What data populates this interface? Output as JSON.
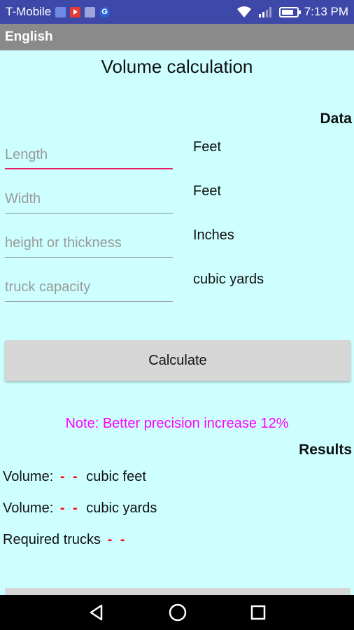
{
  "status_bar": {
    "carrier": "T-Mobile",
    "time": "7:13 PM",
    "icons": [
      "notification-icon",
      "youtube-icon",
      "gallery-icon",
      "google-icon",
      "wifi-icon",
      "signal-icon",
      "battery-icon"
    ]
  },
  "app_bar": {
    "title": "English"
  },
  "page": {
    "title": "Volume calculation",
    "data_label": "Data",
    "results_label": "Results"
  },
  "inputs": {
    "length": {
      "placeholder": "Length",
      "value": "",
      "unit": "Feet"
    },
    "width": {
      "placeholder": "Width",
      "value": "",
      "unit": "Feet"
    },
    "height": {
      "placeholder": "height or thickness",
      "value": "",
      "unit": "Inches"
    },
    "truck": {
      "placeholder": "truck capacity",
      "value": "",
      "unit": "cubic yards"
    }
  },
  "calculate_label": "Calculate",
  "note": "Note: Better precision increase 12%",
  "results": {
    "volume_feet": {
      "label": "Volume:",
      "value": "- -",
      "unit": "cubic feet"
    },
    "volume_yards": {
      "label": "Volume:",
      "value": "- -",
      "unit": "cubic yards"
    },
    "trucks": {
      "label": "Required trucks",
      "value": "- -"
    }
  },
  "colors": {
    "background": "#ccfffe",
    "status_bar": "#3e48a8",
    "app_bar": "#8a8a8a",
    "focus_underline": "#e91e63",
    "note": "#ff00ff",
    "result_dash": "#ff0000"
  }
}
